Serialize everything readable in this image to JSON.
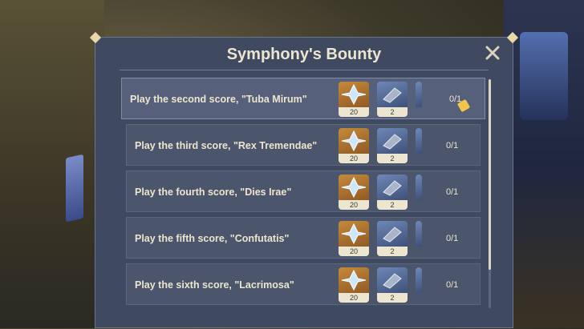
{
  "dialog": {
    "title": "Symphony's Bounty",
    "close_icon": "close-icon"
  },
  "tasks": [
    {
      "label": "Play the second score, \"Tuba Mirum\"",
      "progress": "0/1",
      "rewards": [
        {
          "icon": "primogem-icon",
          "qty": "20"
        },
        {
          "icon": "hero-wit-icon",
          "qty": "2"
        }
      ],
      "selected": true
    },
    {
      "label": "Play the third score, \"Rex Tremendae\"",
      "progress": "0/1",
      "rewards": [
        {
          "icon": "primogem-icon",
          "qty": "20"
        },
        {
          "icon": "hero-wit-icon",
          "qty": "2"
        }
      ],
      "selected": false
    },
    {
      "label": "Play the fourth score, \"Dies Irae\"",
      "progress": "0/1",
      "rewards": [
        {
          "icon": "primogem-icon",
          "qty": "20"
        },
        {
          "icon": "hero-wit-icon",
          "qty": "2"
        }
      ],
      "selected": false
    },
    {
      "label": "Play the fifth score, \"Confutatis\"",
      "progress": "0/1",
      "rewards": [
        {
          "icon": "primogem-icon",
          "qty": "20"
        },
        {
          "icon": "hero-wit-icon",
          "qty": "2"
        }
      ],
      "selected": false
    },
    {
      "label": "Play the sixth score, \"Lacrimosa\"",
      "progress": "0/1",
      "rewards": [
        {
          "icon": "primogem-icon",
          "qty": "20"
        },
        {
          "icon": "hero-wit-icon",
          "qty": "2"
        }
      ],
      "selected": false
    }
  ],
  "colors": {
    "panel": "#3f4a60",
    "row": "#4b556b",
    "row_selected": "#56607a",
    "text": "#ece5cf",
    "primogem_bg": "#c58a3c",
    "material_bg": "#6f88b8"
  }
}
